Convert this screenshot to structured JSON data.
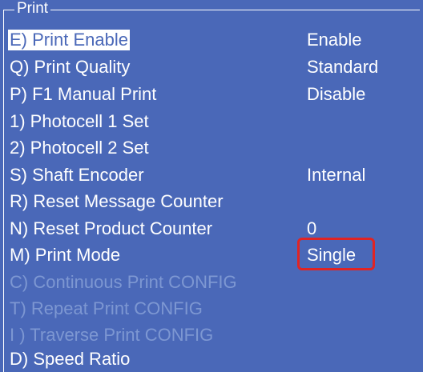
{
  "menu": {
    "title": "Print",
    "items": [
      {
        "label": "E) Print Enable",
        "value": "Enable"
      },
      {
        "label": "Q) Print Quality",
        "value": "Standard"
      },
      {
        "label": "P) F1 Manual Print",
        "value": "Disable"
      },
      {
        "label": "1) Photocell 1 Set",
        "value": ""
      },
      {
        "label": "2) Photocell 2 Set",
        "value": ""
      },
      {
        "label": "S) Shaft Encoder",
        "value": "Internal"
      },
      {
        "label": "R) Reset Message Counter",
        "value": ""
      },
      {
        "label": "N) Reset Product Counter",
        "value": "0"
      },
      {
        "label": "M) Print Mode",
        "value": "Single"
      },
      {
        "label": "C) Continuous Print CONFIG",
        "value": ""
      },
      {
        "label": "T) Repeat Print CONFIG",
        "value": ""
      },
      {
        "label": "I ) Traverse Print CONFIG",
        "value": ""
      },
      {
        "label": "D) Speed Ratio",
        "value": ""
      }
    ]
  },
  "colors": {
    "background": "#4a68b8",
    "text": "#ffffff",
    "disabled_text": "#7d97d2",
    "selection_bg": "#ffffff",
    "annotation_box": "#e02424"
  }
}
